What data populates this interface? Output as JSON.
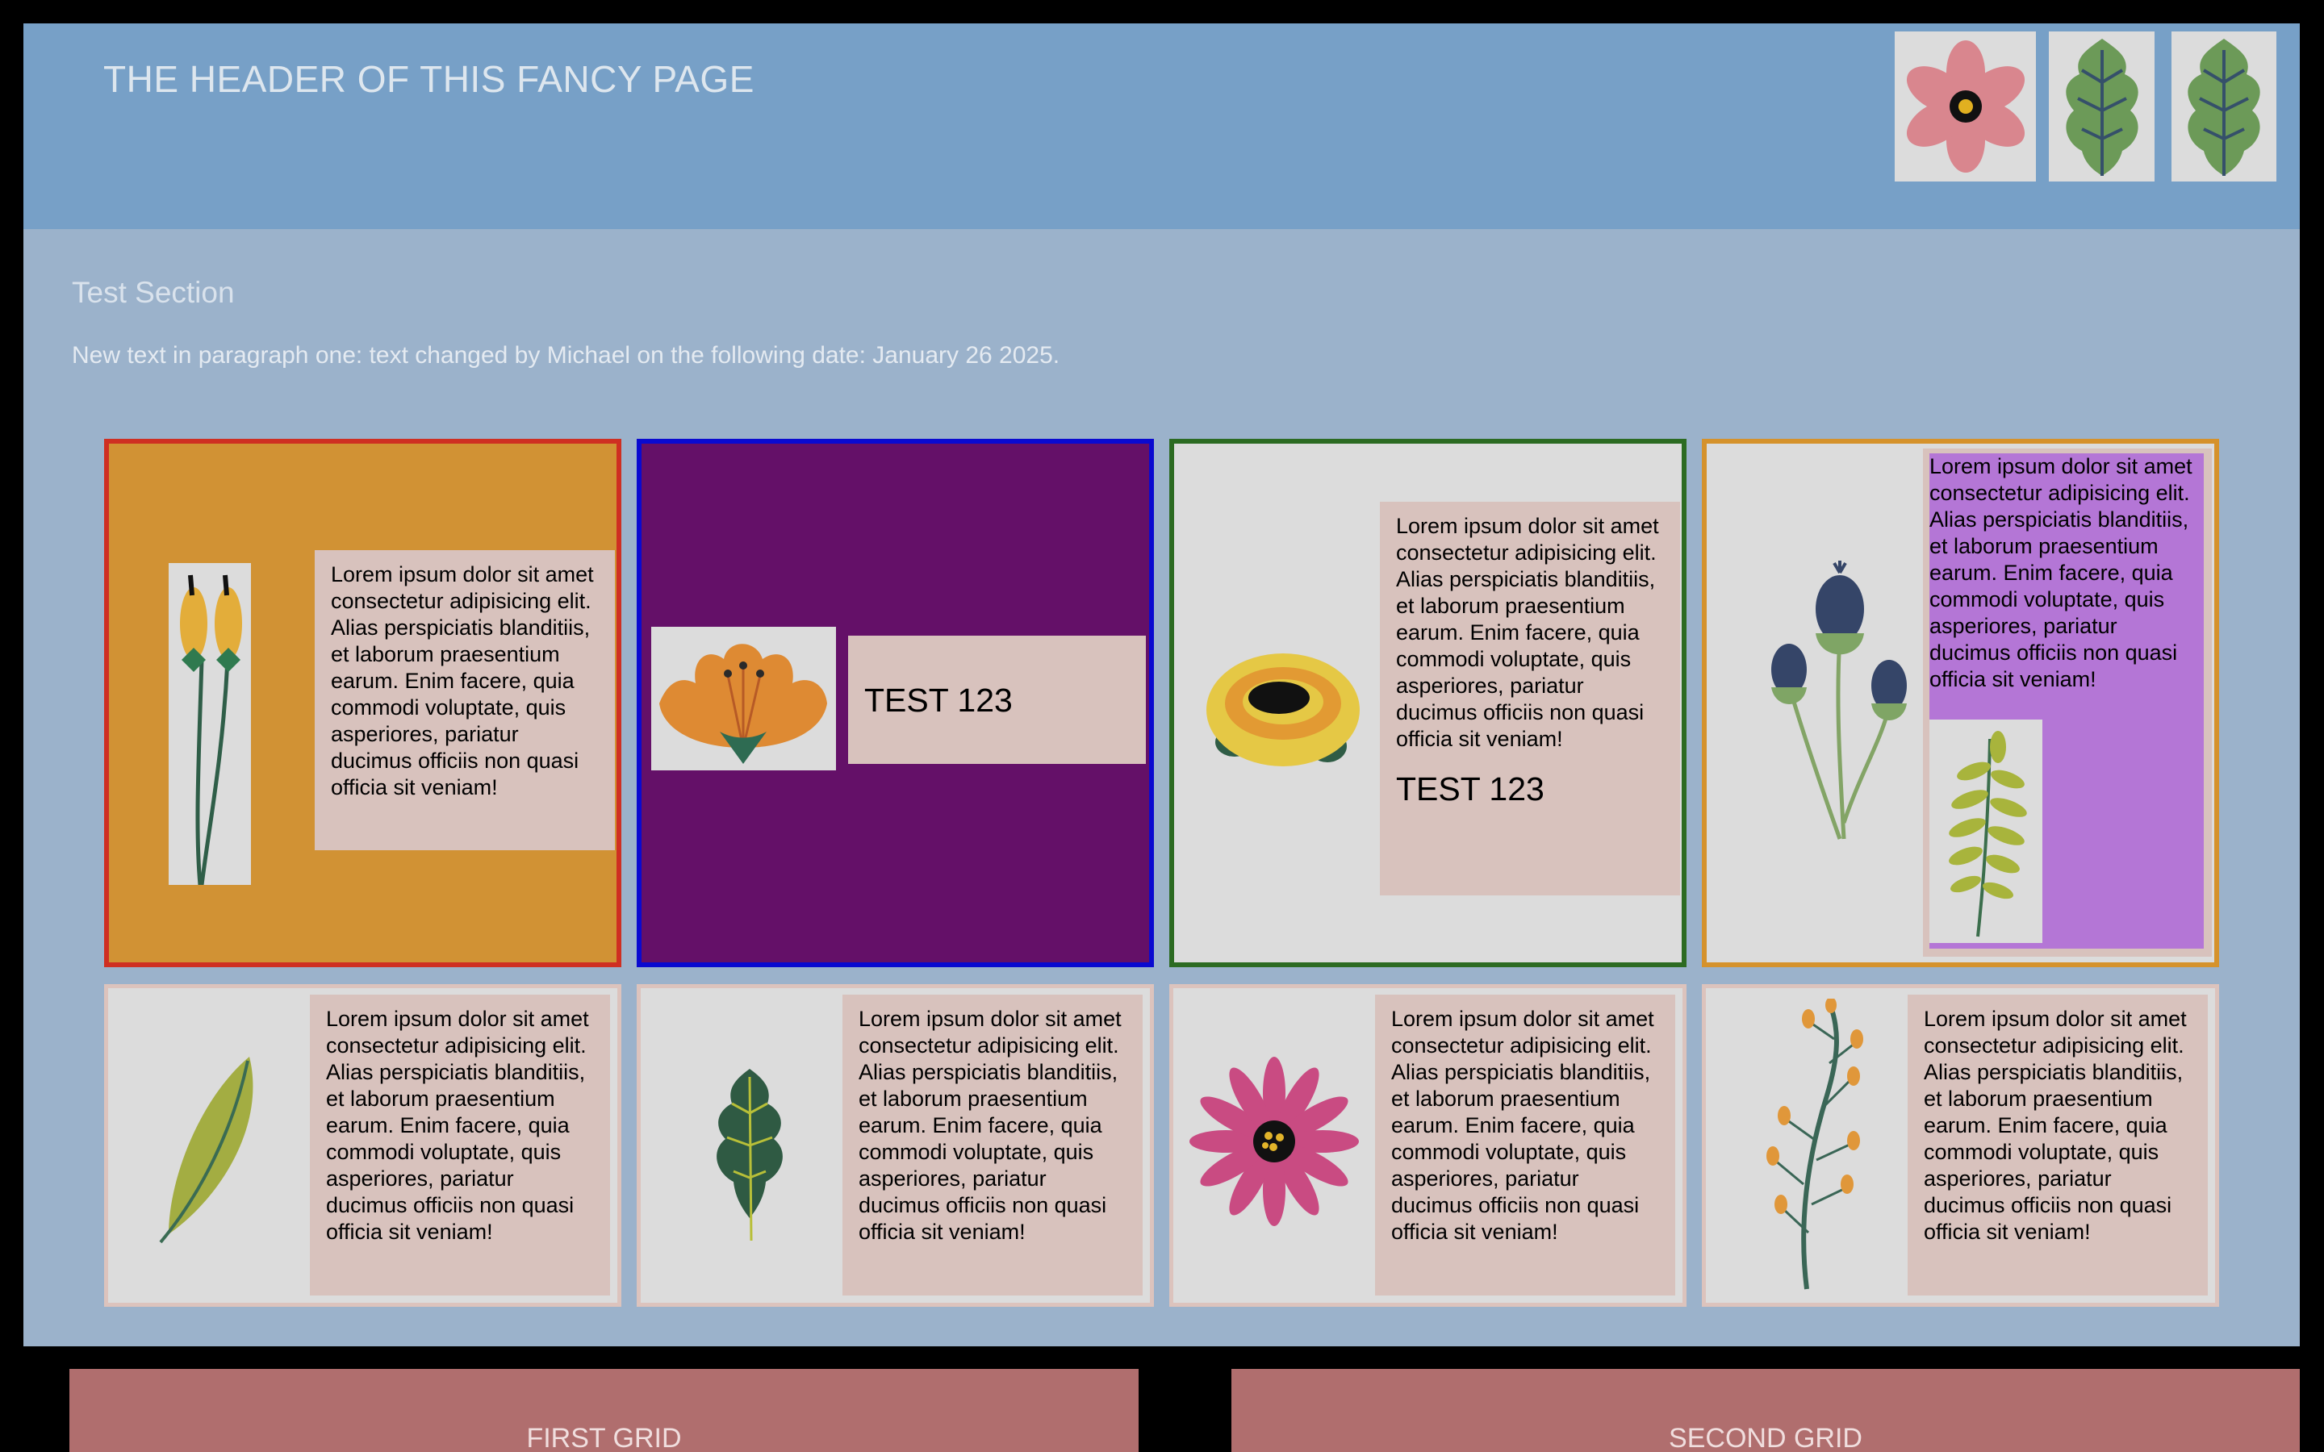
{
  "header": {
    "title": "THE HEADER OF THIS FANCY PAGE",
    "thumbs": [
      "flower-icon",
      "leaf-icon",
      "leaf-icon"
    ]
  },
  "section": {
    "title": "Test Section",
    "paragraph": "New text in paragraph one: text changed by Michael on the following date: January 26 2025."
  },
  "cards_row1": [
    {
      "border": "#cf2f22",
      "bg": "#d19234",
      "icon": "wheat-icon",
      "text": "Lorem ipsum dolor sit amet consectetur adipisicing elit. Alias perspiciatis blanditiis, et laborum praesentium earum. Enim facere, quia commodi voluptate, quis asperiores, pariatur ducimus officiis non quasi officia sit veniam!"
    },
    {
      "border": "#0a0ad0",
      "bg": "#641068",
      "icon": "lily-icon",
      "heading": "TEST 123"
    },
    {
      "border": "#2c6b22",
      "bg": "#dcdcdc",
      "icon": "rose-icon",
      "text": "Lorem ipsum dolor sit amet consectetur adipisicing elit. Alias perspiciatis blanditiis, et laborum praesentium earum. Enim facere, quia commodi voluptate, quis asperiores, pariatur ducimus officiis non quasi officia sit veniam!",
      "heading": "TEST 123"
    },
    {
      "border": "#d5922c",
      "bg": "#dcdcdc",
      "inner_bg": "#b476d6",
      "icon": "thistle-icon",
      "icon2": "fern-icon",
      "text": "Lorem ipsum dolor sit amet consectetur adipisicing elit. Alias perspiciatis blanditiis, et laborum praesentium earum. Enim facere, quia commodi voluptate, quis asperiores, pariatur ducimus officiis non quasi officia sit veniam!"
    }
  ],
  "cards_row2": [
    {
      "icon": "leaf-icon",
      "text": "Lorem ipsum dolor sit amet consectetur adipisicing elit. Alias perspiciatis blanditiis, et laborum praesentium earum. Enim facere, quia commodi voluptate, quis asperiores, pariatur ducimus officiis non quasi officia sit veniam!"
    },
    {
      "icon": "oak-leaf-icon",
      "text": "Lorem ipsum dolor sit amet consectetur adipisicing elit. Alias perspiciatis blanditiis, et laborum praesentium earum. Enim facere, quia commodi voluptate, quis asperiores, pariatur ducimus officiis non quasi officia sit veniam!"
    },
    {
      "icon": "daisy-icon",
      "text": "Lorem ipsum dolor sit amet consectetur adipisicing elit. Alias perspiciatis blanditiis, et laborum praesentium earum. Enim facere, quia commodi voluptate, quis asperiores, pariatur ducimus officiis non quasi officia sit veniam!"
    },
    {
      "icon": "berry-branch-icon",
      "text": "Lorem ipsum dolor sit amet consectetur adipisicing elit. Alias perspiciatis blanditiis, et laborum praesentium earum. Enim facere, quia commodi voluptate, quis asperiores, pariatur ducimus officiis non quasi officia sit veniam!"
    }
  ],
  "footer": {
    "first": "FIRST GRID",
    "second": "SECOND GRID"
  }
}
